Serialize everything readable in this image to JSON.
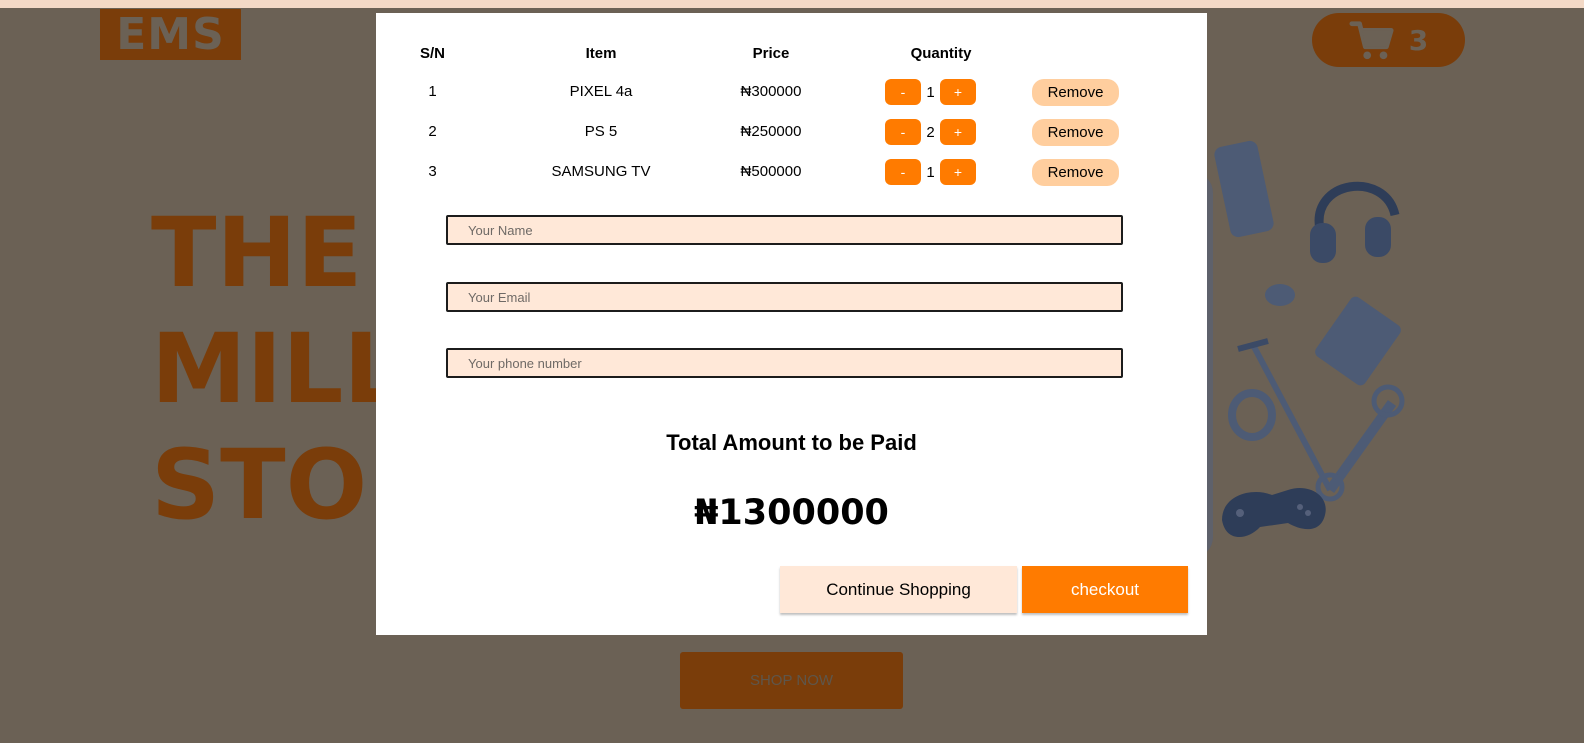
{
  "brand": {
    "logo_text": "EMS"
  },
  "cart": {
    "count": "3",
    "icon": "cart-icon"
  },
  "hero": {
    "line1": "THE",
    "line2": "MILL",
    "line3": "STO",
    "cta": "SHOP NOW"
  },
  "modal": {
    "headers": {
      "sn": "S/N",
      "item": "Item",
      "price": "Price",
      "quantity": "Quantity"
    },
    "rows": [
      {
        "sn": "1",
        "item": "PIXEL 4a",
        "price": "₦300000",
        "qty": "1",
        "minus": "-",
        "plus": "+",
        "remove": "Remove"
      },
      {
        "sn": "2",
        "item": "PS 5",
        "price": "₦250000",
        "qty": "2",
        "minus": "-",
        "plus": "+",
        "remove": "Remove"
      },
      {
        "sn": "3",
        "item": "SAMSUNG TV",
        "price": "₦500000",
        "qty": "1",
        "minus": "-",
        "plus": "+",
        "remove": "Remove"
      }
    ],
    "form": {
      "name_placeholder": "Your Name",
      "email_placeholder": "Your Email",
      "phone_placeholder": "Your phone number"
    },
    "total_label": "Total Amount to be Paid",
    "total_value": "₦1300000",
    "continue_label": "Continue Shopping",
    "checkout_label": "checkout"
  },
  "colors": {
    "accent": "#ff7b00",
    "accent_light": "#ffce9e",
    "field_bg": "#ffe8d8",
    "overlay_bg": "#6b6155",
    "brand_dim": "#7a3d0a"
  }
}
